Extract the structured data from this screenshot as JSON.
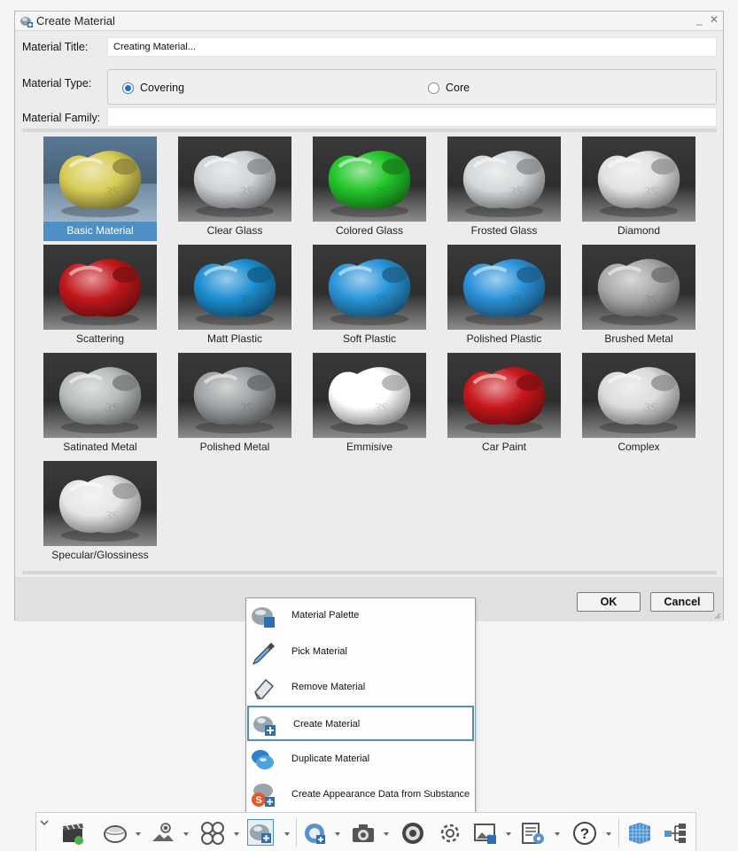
{
  "window": {
    "title": "Create Material",
    "minimize_glyph": "_",
    "close_glyph": "✕"
  },
  "form": {
    "title_label": "Material Title:",
    "title_value": "Creating Material...",
    "type_label": "Material Type:",
    "type_options": [
      {
        "label": "Covering",
        "selected": true
      },
      {
        "label": "Core",
        "selected": false
      }
    ],
    "family_label": "Material Family:",
    "family_value": ""
  },
  "materials": [
    {
      "label": "Basic Material",
      "selected": true,
      "color": "#d9cc57",
      "bg": "#5a7894"
    },
    {
      "label": "Clear Glass",
      "selected": false,
      "color": "#cfd3d6",
      "bg": "#3a3a3a"
    },
    {
      "label": "Colored Glass",
      "selected": false,
      "color": "#23c62a",
      "bg": "#3a3a3a"
    },
    {
      "label": "Frosted Glass",
      "selected": false,
      "color": "#d4d8da",
      "bg": "#3a3a3a"
    },
    {
      "label": "Diamond",
      "selected": false,
      "color": "#e2e2e2",
      "bg": "#3a3a3a"
    },
    {
      "label": "Scattering",
      "selected": false,
      "color": "#c0181c",
      "bg": "#3a3a3a"
    },
    {
      "label": "Matt Plastic",
      "selected": false,
      "color": "#1d8ed0",
      "bg": "#3a3a3a"
    },
    {
      "label": "Soft Plastic",
      "selected": false,
      "color": "#2995d8",
      "bg": "#3a3a3a"
    },
    {
      "label": "Polished Plastic",
      "selected": false,
      "color": "#2b92d8",
      "bg": "#3a3a3a"
    },
    {
      "label": "Brushed Metal",
      "selected": false,
      "color": "#a9a9a9",
      "bg": "#3a3a3a"
    },
    {
      "label": "Satinated Metal",
      "selected": false,
      "color": "#b8bcbd",
      "bg": "#3a3a3a"
    },
    {
      "label": "Polished Metal",
      "selected": false,
      "color": "#9ea2a4",
      "bg": "#3a3a3a"
    },
    {
      "label": "Emmisive",
      "selected": false,
      "color": "#ffffff",
      "bg": "#3a3a3a"
    },
    {
      "label": "Car Paint",
      "selected": false,
      "color": "#c7171c",
      "bg": "#3a3a3a"
    },
    {
      "label": "Complex",
      "selected": false,
      "color": "#dcdcdc",
      "bg": "#3a3a3a"
    },
    {
      "label": "Specular/Glossiness",
      "selected": false,
      "color": "#e6e6e6",
      "bg": "#3a3a3a"
    }
  ],
  "buttons": {
    "ok": "OK",
    "cancel": "Cancel"
  },
  "menu": {
    "items": [
      {
        "label": "Material Palette",
        "icon": "material-palette-icon",
        "active": false
      },
      {
        "label": "Pick Material",
        "icon": "eyedropper-icon",
        "active": false
      },
      {
        "label": "Remove Material",
        "icon": "eraser-icon",
        "active": false
      },
      {
        "label": "Create Material",
        "icon": "create-material-icon",
        "active": true
      },
      {
        "label": "Duplicate Material",
        "icon": "duplicate-material-icon",
        "active": false
      },
      {
        "label": "Create Appearance Data from Substance",
        "icon": "substance-icon",
        "active": false
      }
    ]
  },
  "toolbar": {
    "items": [
      "collapse-chevron-icon",
      "scene-clapper-icon",
      "environment-icon",
      "stage-icon",
      "ambiances-icon",
      "material-icon",
      "sticker-icon",
      "camera-icon",
      "lens-icon",
      "settings-gear-icon",
      "image-output-icon",
      "render-settings-icon",
      "help-icon",
      "texture-grid-icon",
      "tree-icon"
    ]
  },
  "accent_color": "#4e8fc6"
}
